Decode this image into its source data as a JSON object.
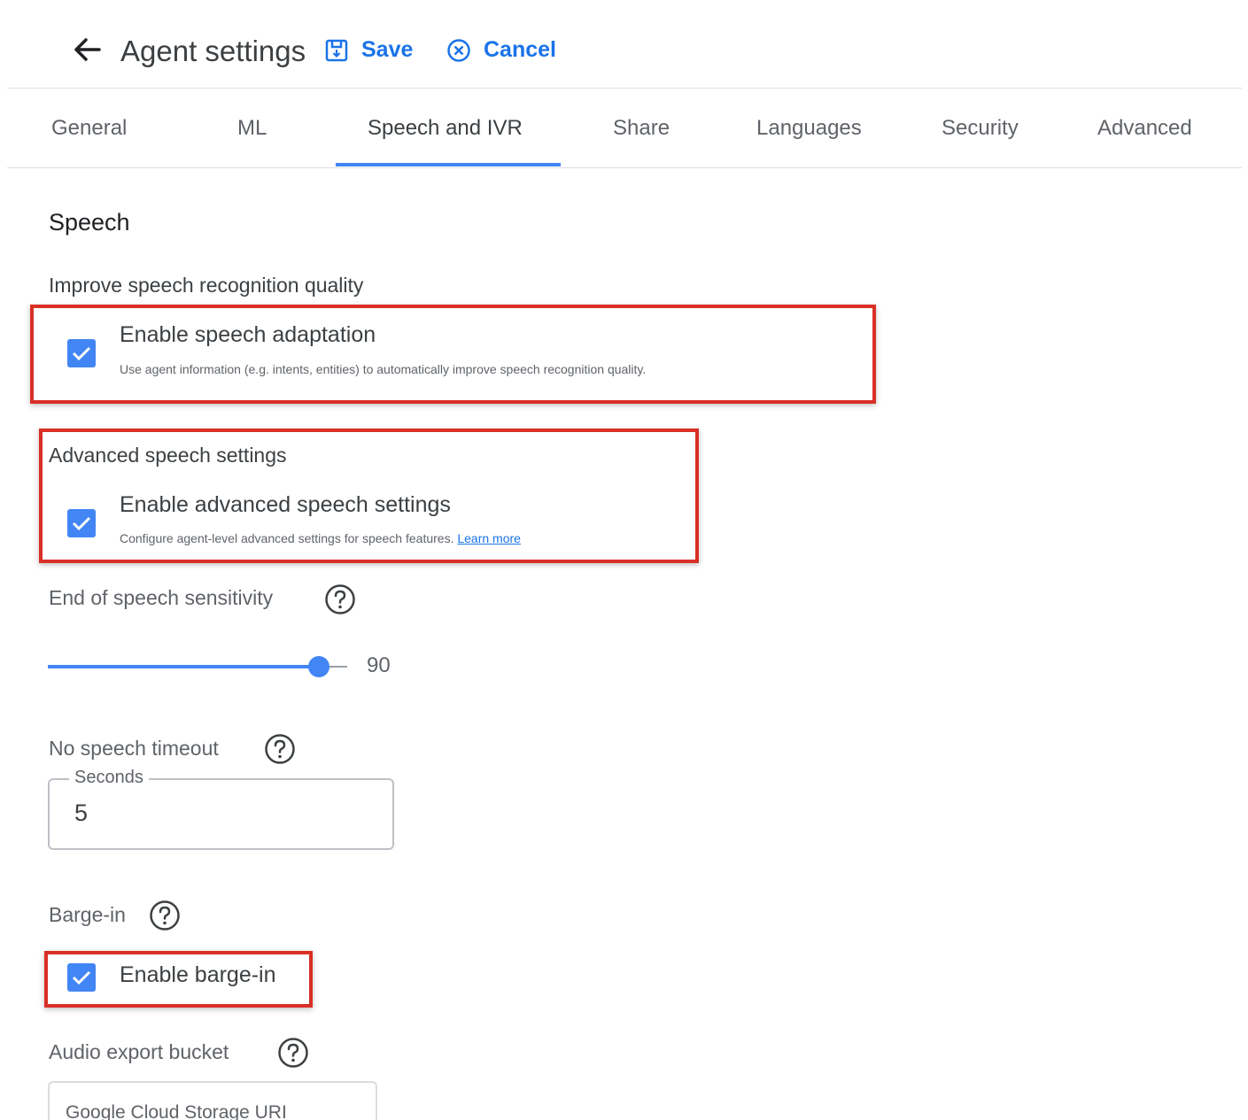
{
  "header": {
    "title": "Agent settings",
    "save_label": "Save",
    "cancel_label": "Cancel",
    "icons": {
      "back": "arrow-back-icon",
      "save": "save-icon",
      "cancel": "cancel-circle-icon"
    }
  },
  "tabs": [
    {
      "label": "General",
      "active": false
    },
    {
      "label": "ML",
      "active": false
    },
    {
      "label": "Speech and IVR",
      "active": true
    },
    {
      "label": "Share",
      "active": false
    },
    {
      "label": "Languages",
      "active": false
    },
    {
      "label": "Security",
      "active": false
    },
    {
      "label": "Advanced",
      "active": false
    }
  ],
  "speech": {
    "section_title": "Speech",
    "improve_quality": {
      "heading": "Improve speech recognition quality",
      "checkbox_label": "Enable speech adaptation",
      "checked": true,
      "description": "Use agent information (e.g. intents, entities) to automatically improve speech recognition quality."
    },
    "advanced": {
      "heading": "Advanced speech settings",
      "checkbox_label": "Enable advanced speech settings",
      "checked": true,
      "description": "Configure agent-level advanced settings for speech features.",
      "link_text": "Learn more"
    },
    "end_of_speech": {
      "label": "End of speech sensitivity",
      "value": 90,
      "value_text": "90"
    },
    "no_speech_timeout": {
      "label": "No speech timeout",
      "field_label": "Seconds",
      "value": "5"
    },
    "barge_in": {
      "label": "Barge-in",
      "checkbox_label": "Enable barge-in",
      "checked": true
    },
    "audio_export": {
      "label": "Audio export bucket",
      "placeholder": "Google Cloud Storage URI"
    }
  },
  "colors": {
    "accent": "#1a73e8",
    "checkbox": "#4285f4",
    "highlight_box": "#d93025"
  }
}
